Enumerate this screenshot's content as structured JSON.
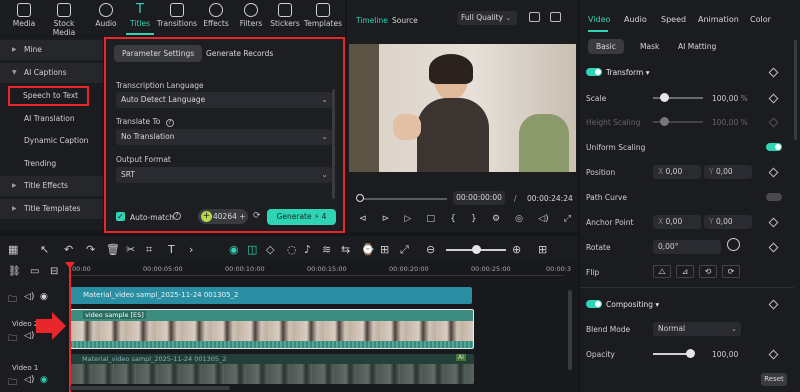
{
  "top_tabs": [
    "Media",
    "Stock Media",
    "Audio",
    "Titles",
    "Transitions",
    "Effects",
    "Filters",
    "Stickers",
    "Templates"
  ],
  "active_tab": "Titles",
  "sidebar": {
    "items": [
      {
        "label": "Mine",
        "group": true
      },
      {
        "label": "AI Captions",
        "group": true
      },
      {
        "label": "Speech to Text",
        "group": false,
        "selected": true
      },
      {
        "label": "AI Translation",
        "group": false
      },
      {
        "label": "Dynamic Caption",
        "group": false
      },
      {
        "label": "Trending",
        "group": false
      },
      {
        "label": "Title Effects",
        "group": true
      },
      {
        "label": "Title Templates",
        "group": true
      }
    ]
  },
  "panel": {
    "tabs": [
      "Parameter Settings",
      "Generate Records"
    ],
    "transcription_language_label": "Transcription Language",
    "transcription_language_value": "Auto Detect Language",
    "translate_to_label": "Translate To",
    "translate_to_value": "No Translation",
    "output_format_label": "Output Format",
    "output_format_value": "SRT",
    "auto_match_label": "Auto-match",
    "credits": "40264",
    "generate_label": "Generate",
    "generate_cost": "4"
  },
  "preview": {
    "tabs": [
      "Timeline",
      "Source"
    ],
    "quality": "Full Quality",
    "current_time": "00:00:00:00",
    "separator": "/",
    "total_time": "00:00:24:24"
  },
  "inspector": {
    "tabs": [
      "Video",
      "Audio",
      "Speed",
      "Animation",
      "Color"
    ],
    "subtabs": [
      "Basic",
      "Mask",
      "AI Matting"
    ],
    "transform_label": "Transform",
    "scale_label": "Scale",
    "scale_value": "100,00",
    "scale_unit": "%",
    "height_scaling_label": "Height Scaling",
    "height_scaling_value": "100,00",
    "uniform_scaling_label": "Uniform Scaling",
    "position_label": "Position",
    "position_x": "0,00",
    "position_y": "0,00",
    "path_curve_label": "Path Curve",
    "anchor_point_label": "Anchor Point",
    "anchor_x": "0,00",
    "anchor_y": "0,00",
    "rotate_label": "Rotate",
    "rotate_value": "0,00°",
    "flip_label": "Flip",
    "compositing_label": "Compositing",
    "blend_mode_label": "Blend Mode",
    "blend_mode_value": "Normal",
    "opacity_label": "Opacity",
    "opacity_value": "100,00",
    "reset_label": "Reset",
    "x_label": "X",
    "y_label": "Y"
  },
  "timeline": {
    "ruler": [
      "00:00",
      "00:00:05:00",
      "00:00:10:00",
      "00:00:15:00",
      "00:00:20:00",
      "00:00:25:00",
      "00:00:3"
    ],
    "title_clip": "Material_video sampl_2025-11-24 001305_2",
    "video_clip": "video sample [ES]",
    "lower_clip": "Material_video sampl_2025-11-24 001305_2",
    "track_label_2": "Video 2",
    "track_label_1": "Video 1",
    "ai_badge": "AI"
  },
  "colors": {
    "accent": "#2fd4b4",
    "highlight": "#e8262b",
    "bg": "#151619"
  }
}
